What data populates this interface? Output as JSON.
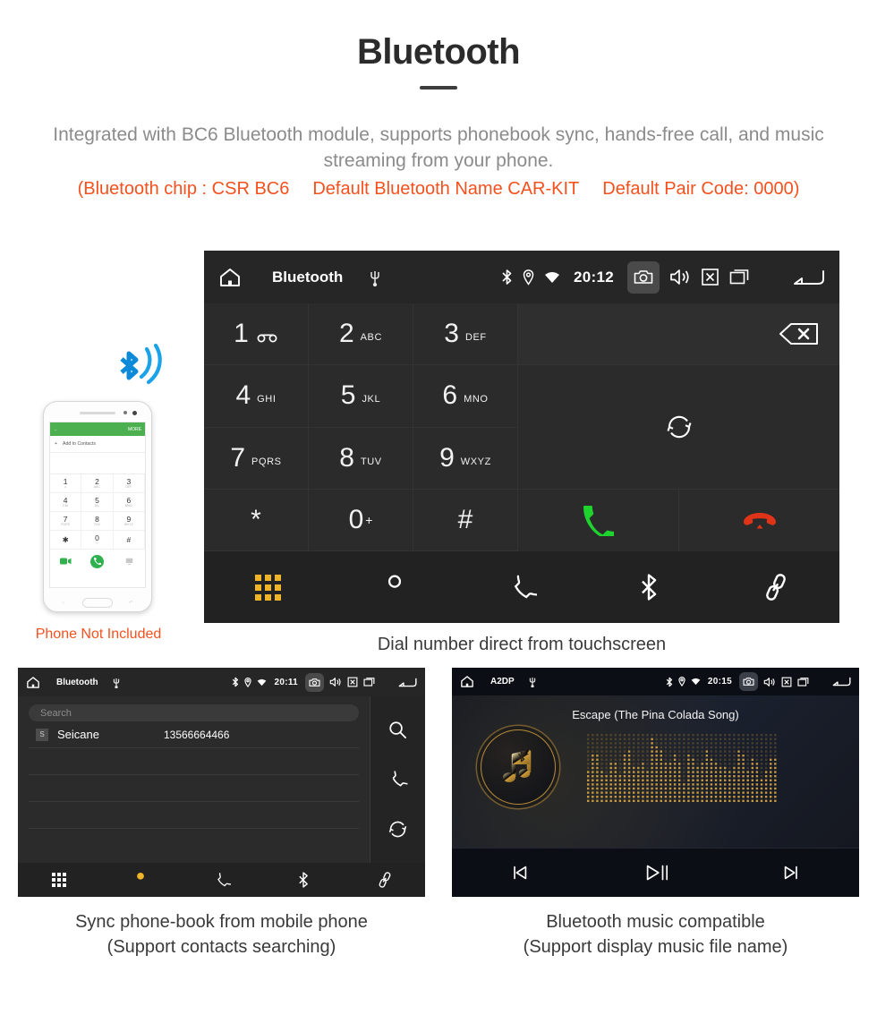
{
  "header": {
    "title": "Bluetooth",
    "subtitle": "Integrated with BC6 Bluetooth module, supports phonebook sync, hands-free call, and music streaming from your phone.",
    "spec_chip": "(Bluetooth chip : CSR BC6",
    "spec_name": "Default Bluetooth Name CAR-KIT",
    "spec_pair": "Default Pair Code: 0000)",
    "accent_color": "#f4511e",
    "subtitle_color": "#8b8b8b"
  },
  "main_unit": {
    "statusbar": {
      "home_icon": "home-icon",
      "title": "Bluetooth",
      "usb_icon": "usb-icon",
      "bluetooth_icon": "bluetooth-icon",
      "location_icon": "location-icon",
      "wifi_icon": "wifi-icon",
      "time": "20:12",
      "camera_icon": "camera-icon",
      "volume_icon": "volume-icon",
      "close_icon": "close-box-icon",
      "recents_icon": "recents-icon",
      "back_icon": "back-arrow-icon"
    },
    "keys": [
      {
        "num": "1",
        "sub": "",
        "icon": "voicemail-icon"
      },
      {
        "num": "2",
        "sub": "ABC",
        "icon": ""
      },
      {
        "num": "3",
        "sub": "DEF",
        "icon": ""
      },
      {
        "num": "4",
        "sub": "GHI",
        "icon": ""
      },
      {
        "num": "5",
        "sub": "JKL",
        "icon": ""
      },
      {
        "num": "6",
        "sub": "MNO",
        "icon": ""
      },
      {
        "num": "7",
        "sub": "PQRS",
        "icon": ""
      },
      {
        "num": "8",
        "sub": "TUV",
        "icon": ""
      },
      {
        "num": "9",
        "sub": "WXYZ",
        "icon": ""
      },
      {
        "num": "*",
        "sub": "",
        "icon": ""
      },
      {
        "num": "0",
        "sub": "",
        "icon": "plus-superscript"
      },
      {
        "num": "#",
        "sub": "",
        "icon": ""
      }
    ],
    "number_display": "",
    "backspace_icon": "backspace-icon",
    "redial_icon": "sync-icon",
    "call_icon": "call-green-icon",
    "hangup_icon": "hangup-red-icon",
    "call_color": "#1fd32e",
    "hangup_color": "#e03419",
    "navbar": [
      {
        "icon": "keypad-icon",
        "active": true
      },
      {
        "icon": "contacts-icon",
        "active": false
      },
      {
        "icon": "call-log-icon",
        "active": false
      },
      {
        "icon": "bluetooth-icon",
        "active": false
      },
      {
        "icon": "link-icon",
        "active": false
      }
    ],
    "active_color": "#f0b429",
    "caption": "Dial number direct from touchscreen"
  },
  "phone_mock": {
    "topbar_back_icon": "back-arrow-icon",
    "topbar_more": "MORE",
    "add_contacts": "Add to Contacts",
    "add_icon": "plus-icon",
    "keys": [
      {
        "num": "1",
        "sub": "∞"
      },
      {
        "num": "2",
        "sub": "ABC"
      },
      {
        "num": "3",
        "sub": "DEF"
      },
      {
        "num": "4",
        "sub": "GHI"
      },
      {
        "num": "5",
        "sub": "JKL"
      },
      {
        "num": "6",
        "sub": "MNO"
      },
      {
        "num": "7",
        "sub": "PQRS"
      },
      {
        "num": "8",
        "sub": "TUV"
      },
      {
        "num": "9",
        "sub": "WXYZ"
      },
      {
        "num": "✱",
        "sub": ""
      },
      {
        "num": "0",
        "sub": "+"
      },
      {
        "num": "#",
        "sub": ""
      }
    ],
    "video_call_icon": "video-call-icon",
    "call_icon": "call-icon",
    "keyboard_icon": "keyboard-icon",
    "not_included_note": "Phone Not Included",
    "bluetooth_wave_icon": "bluetooth-signal-icon",
    "bluetooth_wave_color": "#1aa3e8"
  },
  "phonebook_unit": {
    "statusbar": {
      "home_icon": "home-icon",
      "title": "Bluetooth",
      "usb_icon": "usb-icon",
      "time": "20:11",
      "camera_icon": "camera-icon"
    },
    "search_placeholder": "Search",
    "contacts": [
      {
        "initial": "S",
        "name": "Seicane",
        "number": "13566664466"
      }
    ],
    "side_icons": [
      "search-icon",
      "call-log-icon",
      "sync-icon"
    ],
    "navbar": [
      {
        "icon": "keypad-icon",
        "active": false
      },
      {
        "icon": "contacts-icon",
        "active": true
      },
      {
        "icon": "call-log-icon",
        "active": false
      },
      {
        "icon": "bluetooth-icon",
        "active": false
      },
      {
        "icon": "link-icon",
        "active": false
      }
    ],
    "caption_line1": "Sync phone-book from mobile phone",
    "caption_line2": "(Support contacts searching)"
  },
  "music_unit": {
    "statusbar": {
      "home_icon": "home-icon",
      "title": "A2DP",
      "usb_icon": "usb-icon",
      "time": "20:15",
      "camera_icon": "camera-icon"
    },
    "song_title": "Escape (The Pina Colada Song)",
    "album_art_icon": "bluetooth-music-note-icon",
    "equalizer_icon": "dot-matrix-equalizer",
    "accent_color": "#c79a3f",
    "controls": [
      {
        "icon": "previous-track-icon"
      },
      {
        "icon": "play-pause-icon"
      },
      {
        "icon": "next-track-icon"
      }
    ],
    "caption_line1": "Bluetooth music compatible",
    "caption_line2": "(Support display music file name)"
  }
}
